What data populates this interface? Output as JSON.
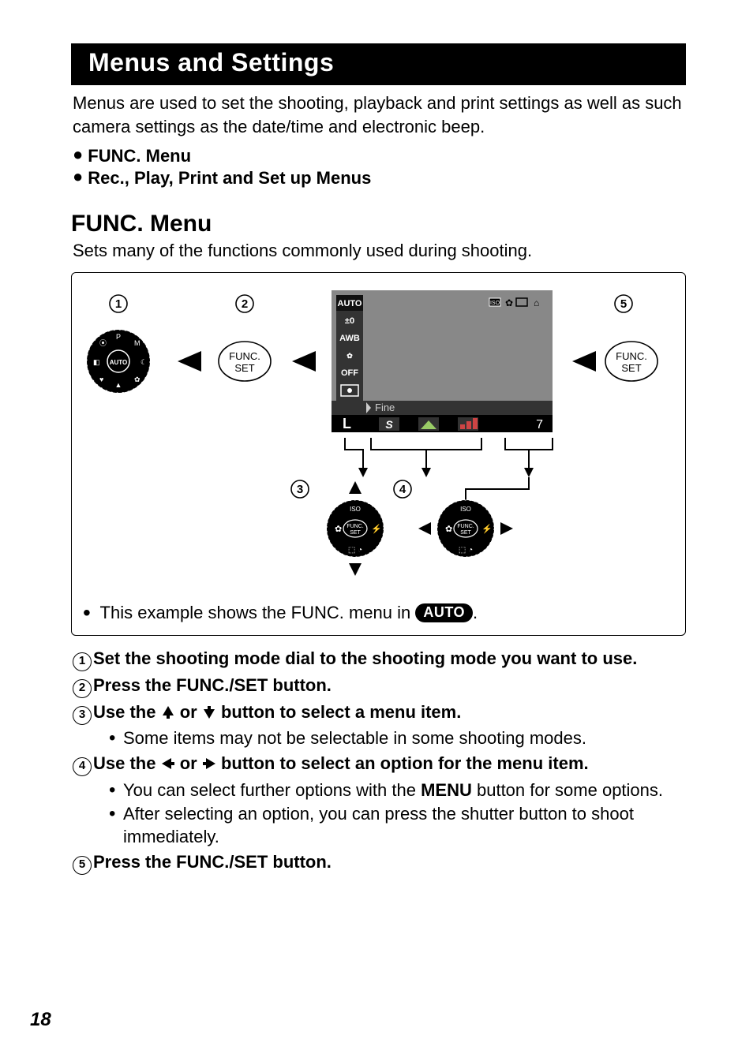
{
  "page_number": "18",
  "title": "Menus and Settings",
  "intro": "Menus are used to set the shooting, playback and print settings as well as such camera settings as the date/time and electronic beep.",
  "bullets": [
    "FUNC. Menu",
    "Rec., Play, Print and Set up Menus"
  ],
  "section": {
    "heading": "FUNC. Menu",
    "desc": "Sets many of the functions commonly used during shooting."
  },
  "diagram": {
    "callouts": {
      "c1": "1",
      "c2": "2",
      "c3": "3",
      "c4": "4",
      "c5": "5"
    },
    "func_set": "FUNC.\nSET",
    "lcd_items": [
      "AUTO",
      "±0",
      "AWB",
      "OFF"
    ],
    "lcd_fine": "Fine",
    "lcd_L": "L",
    "lcd_S": "S",
    "lcd_7": "7",
    "iso_label": "ISO",
    "caption_pre": "This example shows the FUNC. menu in ",
    "caption_pill": "AUTO",
    "caption_post": "."
  },
  "steps": [
    {
      "n": "1",
      "text": "Set the shooting mode dial to the shooting mode you want to use."
    },
    {
      "n": "2",
      "text": "Press the FUNC./SET button."
    },
    {
      "n": "3",
      "pre": "Use the ",
      "mid": " or ",
      "post": " button to select a menu item.",
      "arrows": [
        "up",
        "down"
      ],
      "subs": [
        "Some items may not be selectable in some shooting modes."
      ]
    },
    {
      "n": "4",
      "pre": "Use the ",
      "mid": " or ",
      "post": " button to select an option for the menu item.",
      "arrows": [
        "left",
        "right"
      ],
      "subs": [
        "You can select further options with the MENU button for some options.",
        "After selecting an option, you can press the shutter button to shoot immediately."
      ],
      "bold_word": "MENU"
    },
    {
      "n": "5",
      "text": "Press the FUNC./SET button."
    }
  ]
}
